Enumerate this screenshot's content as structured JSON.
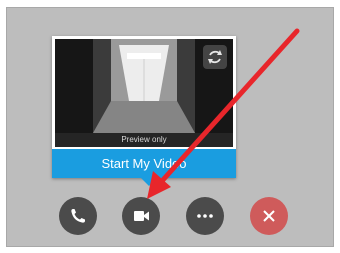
{
  "video_popup": {
    "preview_caption": "Preview only",
    "start_video_label": "Start My Video"
  },
  "call_controls": [
    {
      "icon": "phone-icon",
      "action": "call"
    },
    {
      "icon": "video-camera-icon",
      "action": "video"
    },
    {
      "icon": "ellipsis-icon",
      "action": "more"
    },
    {
      "icon": "close-icon",
      "action": "end"
    }
  ],
  "colors": {
    "frame_background": "#bdbdbd",
    "primary_button": "#1a9de0",
    "control_button": "#4b4b4b",
    "end_button": "#cf5b5b",
    "annotation_arrow": "#e8262b"
  }
}
